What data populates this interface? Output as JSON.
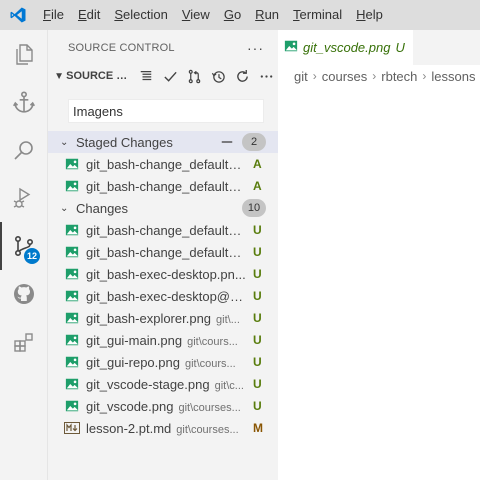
{
  "menu": {
    "items": [
      {
        "label": "File",
        "u": "F",
        "rest": "ile"
      },
      {
        "label": "Edit",
        "u": "E",
        "rest": "dit"
      },
      {
        "label": "Selection",
        "u": "S",
        "rest": "election"
      },
      {
        "label": "View",
        "u": "V",
        "rest": "iew"
      },
      {
        "label": "Go",
        "u": "G",
        "rest": "o"
      },
      {
        "label": "Run",
        "u": "R",
        "rest": "un"
      },
      {
        "label": "Terminal",
        "u": "T",
        "rest": "erminal"
      },
      {
        "label": "Help",
        "u": "H",
        "rest": "elp"
      }
    ]
  },
  "activity": {
    "scm_badge": "12",
    "icons": [
      "explorer-icon",
      "anchor-icon",
      "search-icon",
      "run-debug-icon",
      "source-control-icon",
      "github-icon",
      "extensions-icon"
    ]
  },
  "sidebar": {
    "title": "SOURCE CONTROL",
    "more": "···",
    "repo_label": "SOURCE C...",
    "commit_message": "Imagens",
    "staged": {
      "label": "Staged Changes",
      "count": "2",
      "files": [
        {
          "name": "git_bash-change_default_f...",
          "dir": "",
          "status": "A",
          "icon": "image-file-icon"
        },
        {
          "name": "git_bash-change_default_f...",
          "dir": "",
          "status": "A",
          "icon": "image-file-icon"
        }
      ]
    },
    "changes": {
      "label": "Changes",
      "count": "10",
      "files": [
        {
          "name": "git_bash-change_default_f...",
          "dir": "",
          "status": "U",
          "icon": "image-file-icon"
        },
        {
          "name": "git_bash-change_default_f...",
          "dir": "",
          "status": "U",
          "icon": "image-file-icon"
        },
        {
          "name": "git_bash-exec-desktop.pn...",
          "dir": "",
          "status": "U",
          "icon": "image-file-icon"
        },
        {
          "name": "git_bash-exec-desktop@0,...",
          "dir": "",
          "status": "U",
          "icon": "image-file-icon"
        },
        {
          "name": "git_bash-explorer.png",
          "dir": "git\\...",
          "status": "U",
          "icon": "image-file-icon"
        },
        {
          "name": "git_gui-main.png",
          "dir": "git\\cours...",
          "status": "U",
          "icon": "image-file-icon"
        },
        {
          "name": "git_gui-repo.png",
          "dir": "git\\cours...",
          "status": "U",
          "icon": "image-file-icon"
        },
        {
          "name": "git_vscode-stage.png",
          "dir": "git\\c...",
          "status": "U",
          "icon": "image-file-icon"
        },
        {
          "name": "git_vscode.png",
          "dir": "git\\courses...",
          "status": "U",
          "icon": "image-file-icon"
        },
        {
          "name": "lesson-2.pt.md",
          "dir": "git\\courses...",
          "status": "M",
          "icon": "markdown-file-icon"
        }
      ]
    }
  },
  "editor": {
    "tab": {
      "name": "git_vscode.png",
      "status": "U"
    },
    "breadcrumb": [
      "git",
      "courses",
      "rbtech",
      "lessons"
    ]
  },
  "colors": {
    "accent": "#007acc",
    "image_icon": "#1e9e6a",
    "status_added": "#587c0c",
    "status_modified": "#895503"
  }
}
